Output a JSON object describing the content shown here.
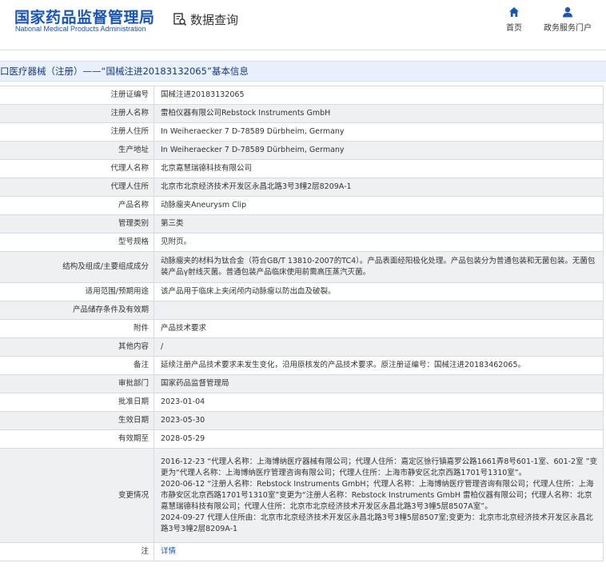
{
  "header": {
    "site_title": "国家药品监督管理局",
    "site_subtitle": "National Medical Products Administration",
    "query_label": "数据查询",
    "nav": [
      {
        "label": "首页",
        "icon": "home-icon"
      },
      {
        "label": "政务服务门户",
        "icon": "user-icon"
      }
    ]
  },
  "section": {
    "title": "口医疗器械（注册）——“国械注进20183132065”基本信息"
  },
  "rows": [
    {
      "label": "注册证编号",
      "value": "国械注进20183132065"
    },
    {
      "label": "注册人名称",
      "value": "雷柏仪器有限公司Rebstock Instruments GmbH"
    },
    {
      "label": "注册人住所",
      "value": "In Weiheraecker 7 D-78589 Dürbheim, Germany"
    },
    {
      "label": "生产地址",
      "value": "In Weiheraecker 7 D-78589 Dürbheim, Germany"
    },
    {
      "label": "代理人名称",
      "value": "北京嘉慧瑞德科技有限公司"
    },
    {
      "label": "代理人住所",
      "value": "北京市北京经济技术开发区永昌北路3号3幢2层8209A-1"
    },
    {
      "label": "产品名称",
      "value": "动脉瘤夹Aneurysm Clip"
    },
    {
      "label": "管理类别",
      "value": "第三类"
    },
    {
      "label": "型号规格",
      "value": "见附页。"
    },
    {
      "label": "结构及组成/主要组成成分",
      "value": "动脉瘤夹的材料为钛合金（符合GB/T 13810-2007的TC4）。产品表面经阳极化处理。产品包装分为普通包装和无菌包装。无菌包装产品γ射线灭菌。普通包装产品临床使用前需高压蒸汽灭菌。"
    },
    {
      "label": "适用范围/预期用途",
      "value": "该产品用于临床上夹闭颅内动脉瘤以防出血及破裂。"
    },
    {
      "label": "产品储存条件及有效期",
      "value": ""
    },
    {
      "label": "附件",
      "value": "产品技术要求"
    },
    {
      "label": "其他内容",
      "value": "/"
    },
    {
      "label": "备注",
      "value": "延续注册产品技术要求未发生变化，沿用原核发的产品技术要求。原注册证编号：国械注进20183462065。"
    },
    {
      "label": "审批部门",
      "value": "国家药品监督管理局"
    },
    {
      "label": "批准日期",
      "value": "2023-01-04"
    },
    {
      "label": "生效日期",
      "value": "2023-05-30"
    },
    {
      "label": "有效期至",
      "value": "2028-05-29"
    },
    {
      "label": "变更情况",
      "value": ""
    },
    {
      "label": "注",
      "value": "详情"
    }
  ],
  "changes": [
    "2016-12-23 “代理人名称：上海博纳医疗器械有限公司；代理人住所：嘉定区徐行镇嘉罗公路1661弄8号601-1室、601-2室 ”变更为“代理人名称：上海博纳医疗管理咨询有限公司；代理人住所：上海市静安区北京西路1701号1310室”。",
    "2020-06-12 “注册人名称：Rebstock Instruments GmbH；代理人名称：上海博纳医疗管理咨询有限公司；代理人住所：上海市静安区北京西路1701号1310室”变更为“注册人名称：Rebstock Instruments GmbH 雷柏仪器有限公司；代理人名称：北京嘉慧瑞德科技有限公司；代理人住所：北京市北京经济技术开发区永昌北路3号3幢5层8507A室”。",
    "2024-09-27 代理人住所由：北京市北京经济技术开发区永昌北路3号3幢5层8507室;变更为：北京市北京经济技术开发区永昌北路3号3幢2层8209A-1"
  ],
  "colors": {
    "brand_blue": "#1a55b4",
    "section_bg": "#e8f0fb",
    "alt_row_bg": "#eef0f2",
    "border": "#d6dbe2"
  }
}
